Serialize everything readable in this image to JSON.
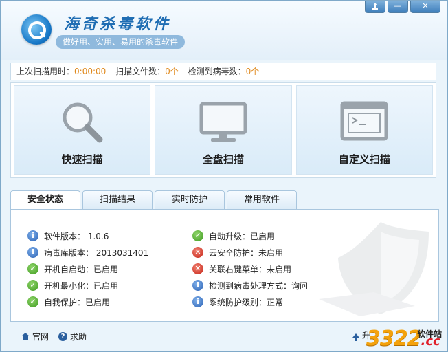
{
  "app": {
    "title": "海奇杀毒软件",
    "slogan": "做好用、实用、易用的杀毒软件"
  },
  "window_controls": {
    "skin_icon": "recycle-icon",
    "minimize": "—",
    "close": "✕"
  },
  "stats": {
    "last_scan_label": "上次扫描用时：",
    "last_scan_value": "0:00:00",
    "files_label": "扫描文件数：",
    "files_value": "0个",
    "virus_label": "检测到病毒数：",
    "virus_value": "0个"
  },
  "scan": {
    "quick": "快速扫描",
    "full": "全盘扫描",
    "custom": "自定义扫描"
  },
  "tabs": [
    {
      "label": "安全状态"
    },
    {
      "label": "扫描结果"
    },
    {
      "label": "实时防护"
    },
    {
      "label": "常用软件"
    }
  ],
  "status_left": [
    {
      "icon": "info",
      "text": "软件版本：  1.0.6"
    },
    {
      "icon": "info",
      "text": "病毒库版本：  2013031401"
    },
    {
      "icon": "ok",
      "text": "开机自启动：已启用"
    },
    {
      "icon": "ok",
      "text": "开机最小化：已启用"
    },
    {
      "icon": "ok",
      "text": "自我保护：已启用"
    }
  ],
  "status_right": [
    {
      "icon": "ok",
      "text": "自动升级：已启用"
    },
    {
      "icon": "err",
      "text": "云安全防护：未启用"
    },
    {
      "icon": "err",
      "text": "关联右键菜单：未启用"
    },
    {
      "icon": "info",
      "text": "检测到病毒处理方式：询问"
    },
    {
      "icon": "info",
      "text": "系统防护级别：正常"
    }
  ],
  "footer": {
    "home": "官网",
    "help": "求助",
    "update": "升"
  },
  "watermark": {
    "num": "3322",
    "cc": ".cc",
    "tag": "软件站"
  },
  "colors": {
    "accent": "#1f6db3",
    "value_orange": "#e08a1e",
    "ok_green": "#3e9a1f",
    "err_red": "#c52418",
    "info_blue": "#2c62b5"
  }
}
